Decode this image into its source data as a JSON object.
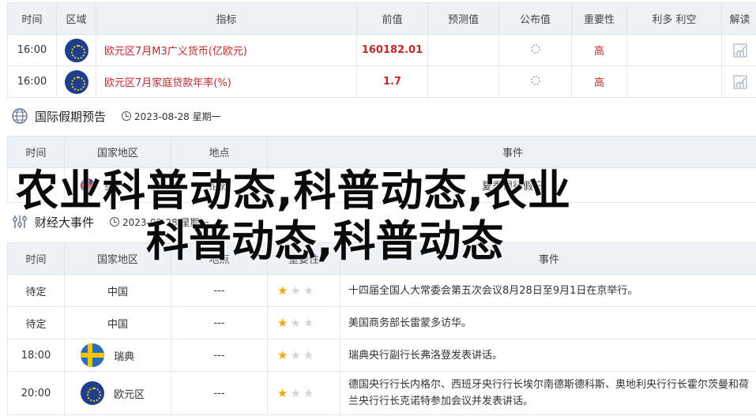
{
  "calendar": {
    "headers": [
      "时间",
      "区域",
      "指标",
      "前值",
      "预测值",
      "公布值",
      "重要性",
      "利多 利空",
      "解读"
    ],
    "rows": [
      {
        "time": "16:00",
        "flag": "eu-flag-icon",
        "indicator": "欧元区7月M3广义货币(亿欧元)",
        "previous": "160182.01",
        "forecast": "",
        "actual": "",
        "importance": "高"
      },
      {
        "time": "16:00",
        "flag": "eu-flag-icon",
        "indicator": "欧元区7月家庭贷款年率(%)",
        "previous": "1.7",
        "forecast": "",
        "actual": "",
        "importance": "高"
      }
    ]
  },
  "holiday_section": {
    "title": "国际假期预告",
    "date": "2023-08-28 星期一"
  },
  "holiday": {
    "headers": [
      "时间",
      "国家地区",
      "地点",
      "事件"
    ],
    "row": {
      "country": "英",
      "place": "伦敦",
      "event": "夏季银行假日"
    }
  },
  "events_section": {
    "title": "财经大事件",
    "date": "2023-08-28 星期一"
  },
  "events": {
    "headers": [
      "时间",
      "国家地区",
      "地点",
      "重要性",
      "事件"
    ],
    "rows": [
      {
        "time": "待定",
        "country": "中国",
        "flag": "",
        "place": "---",
        "stars": 1,
        "event": "十四届全国人大常委会第五次会议8月28日至9月1日在京举行。"
      },
      {
        "time": "待定",
        "country": "中国",
        "flag": "",
        "place": "---",
        "stars": 1,
        "event": "美国商务部长雷蒙多访华。"
      },
      {
        "time": "18:00",
        "country": "瑞典",
        "flag": "sweden-flag-icon",
        "place": "---",
        "stars": 1,
        "event": "瑞典央行副行长弗洛登发表讲话。"
      },
      {
        "time": "20:00",
        "country": "欧元区",
        "flag": "eu-flag-icon",
        "place": "---",
        "stars": 1,
        "event": "德国央行行长内格尔、西班牙央行行长埃尔南德斯德科斯、奥地利央行行长霍尔茨曼和荷兰央行行长克诺特参加会议并发表讲话。"
      }
    ]
  },
  "watermark": {
    "line1": "农业科普动态,科普动态,农业",
    "line2": "科普动态,科普动态"
  }
}
